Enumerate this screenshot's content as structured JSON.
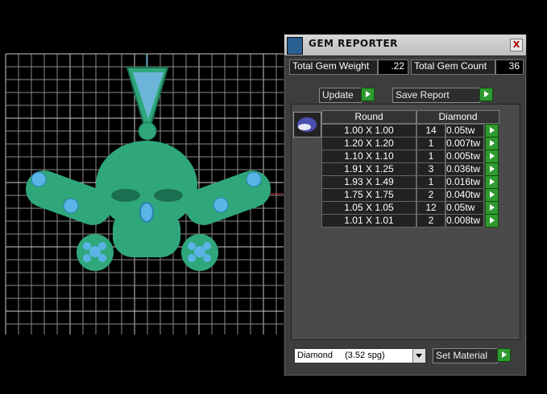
{
  "window": {
    "title": "GEM REPORTER",
    "close_label": "X"
  },
  "stats": {
    "weight_label": "Total Gem Weight",
    "weight_value": ".22",
    "count_label": "Total Gem Count",
    "count_value": "36"
  },
  "toolbar": {
    "update_label": "Update",
    "save_label": "Save Report"
  },
  "table": {
    "header_shape": "Round",
    "header_material": "Diamond",
    "rows": [
      {
        "size": "1.00 X 1.00",
        "count": "14",
        "weight": "0.05tw"
      },
      {
        "size": "1.20 X 1.20",
        "count": "1",
        "weight": "0.007tw"
      },
      {
        "size": "1.10 X 1.10",
        "count": "1",
        "weight": "0.005tw"
      },
      {
        "size": "1.91 X 1.25",
        "count": "3",
        "weight": "0.036tw"
      },
      {
        "size": "1.93 X 1.49",
        "count": "1",
        "weight": "0.016tw"
      },
      {
        "size": "1.75 X 1.75",
        "count": "2",
        "weight": "0.040tw"
      },
      {
        "size": "1.05 X 1.05",
        "count": "12",
        "weight": "0.05tw"
      },
      {
        "size": "1.01 X 1.01",
        "count": "2",
        "weight": "0.008tw"
      }
    ]
  },
  "material": {
    "select_value": "Diamond",
    "select_spg": "(3.52 spg)",
    "set_label": "Set Material"
  },
  "icons": {
    "gem": "gem-thumbnail-icon",
    "arrow": "green-arrow-icon"
  },
  "colors": {
    "model_fill": "#2fa77a",
    "gem_fill": "#5ab4e6",
    "grid": "#9a9a9a",
    "button_green": "#2f9a2f"
  }
}
